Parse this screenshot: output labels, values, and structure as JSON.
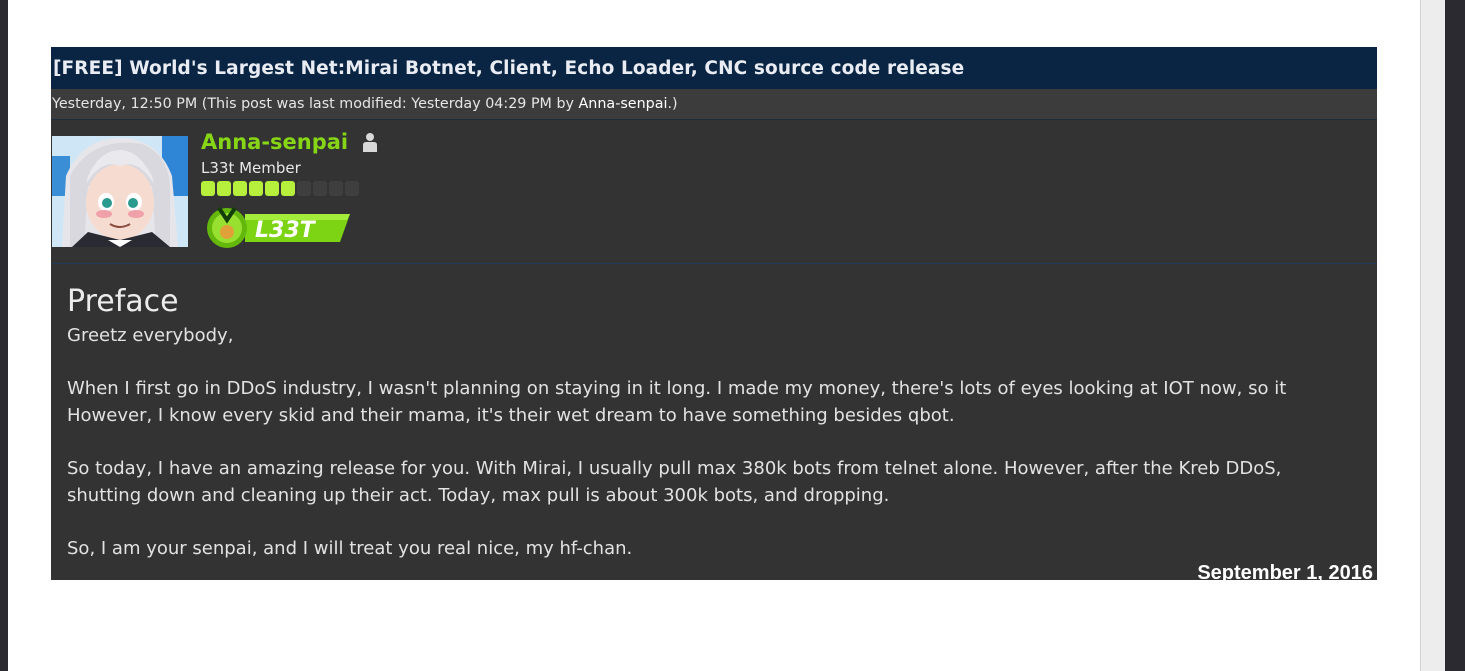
{
  "thread": {
    "title": "[FREE] World's Largest Net:Mirai Botnet, Client, Echo Loader, CNC source code release"
  },
  "meta": {
    "posted": "Yesterday, 12:50 PM",
    "modified_prefix": "(This post was last modified: Yesterday 04:29 PM by",
    "modified_by": "Anna-senpai",
    "modified_suffix": ".)"
  },
  "author": {
    "username": "Anna-senpai",
    "usertitle": "L33t Member",
    "rank_stars_filled": 6,
    "rank_stars_total": 10,
    "badge_text": "L33T",
    "status_icon": "user-icon",
    "colors": {
      "username": "#86d615",
      "badge": "#7dd414"
    }
  },
  "post": {
    "heading": "Preface",
    "paragraphs": [
      [
        "Greetz everybody,"
      ],
      [
        "When I first go in DDoS industry, I wasn't planning on staying in it long. I made my money, there's lots of eyes looking at IOT now, so it",
        "However, I know every skid and their mama, it's their wet dream to have something besides qbot."
      ],
      [
        "So today, I have an amazing release for you. With Mirai, I usually pull max 380k bots from telnet alone. However, after the Kreb DDoS,",
        "shutting down and cleaning up their act. Today, max pull is about 300k bots, and dropping."
      ],
      [
        "So, I am your senpai, and I will treat you real nice, my hf-chan."
      ]
    ]
  },
  "overlay": {
    "date": "September 1, 2016"
  },
  "colors": {
    "title_bar": "#0a2543",
    "post_bg": "#333333",
    "page_bg": "#ffffff"
  }
}
